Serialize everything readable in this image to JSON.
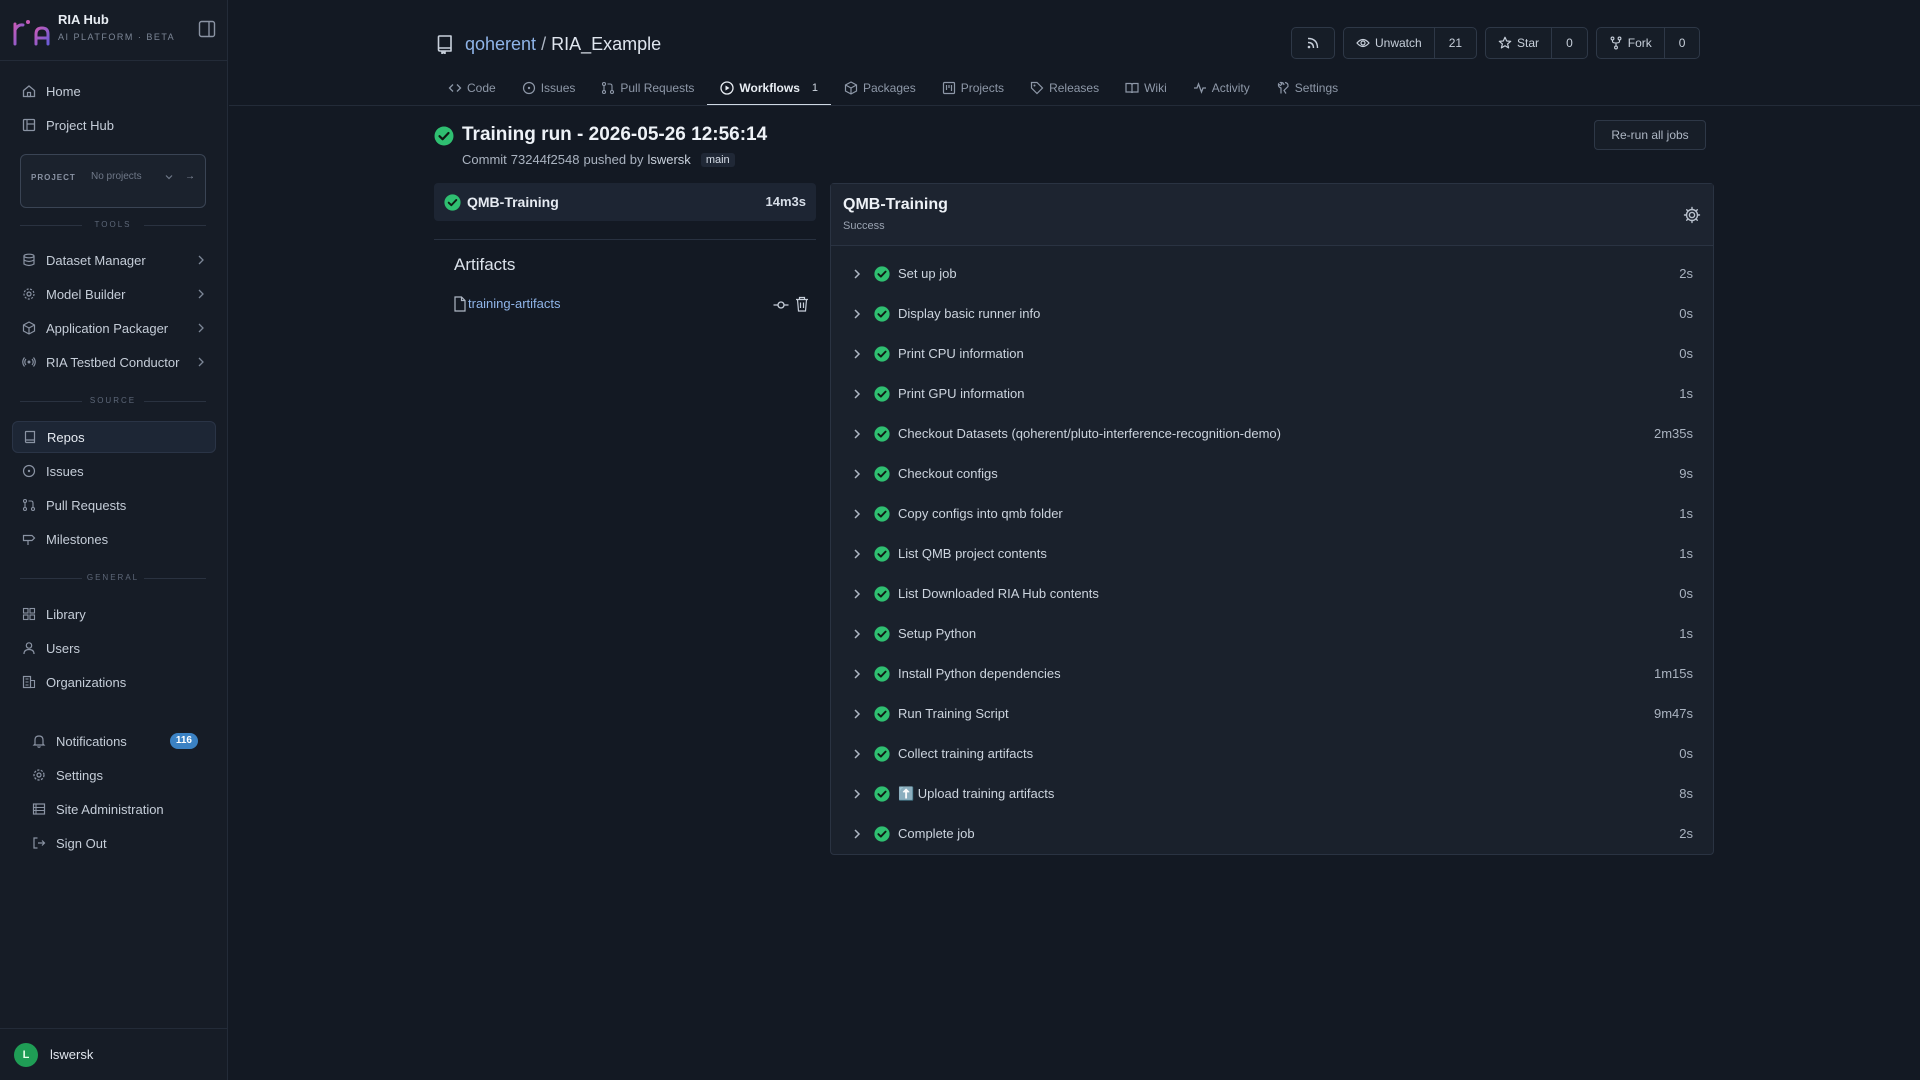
{
  "brand": {
    "name": "RIA Hub",
    "subtitle": "AI PLATFORM · BETA"
  },
  "colors": {
    "success": "#2fbf71",
    "link": "#8fb4e8",
    "badge": "#3b82c4"
  },
  "sidebar": {
    "top_items": [
      {
        "label": "Home",
        "icon": "home-icon"
      },
      {
        "label": "Project Hub",
        "icon": "project-hub-icon"
      }
    ],
    "project_selector": {
      "label": "PROJECT",
      "value": "No projects",
      "arrow": "→"
    },
    "sections": {
      "tools": "TOOLS",
      "source": "SOURCE",
      "general": "GENERAL"
    },
    "tools": [
      {
        "label": "Dataset Manager",
        "icon": "database-icon"
      },
      {
        "label": "Model Builder",
        "icon": "cog-icon"
      },
      {
        "label": "Application Packager",
        "icon": "package-icon"
      },
      {
        "label": "RIA Testbed Conductor",
        "icon": "radio-icon"
      }
    ],
    "source": [
      {
        "label": "Repos",
        "icon": "repo-icon",
        "active": true
      },
      {
        "label": "Issues",
        "icon": "issue-icon"
      },
      {
        "label": "Pull Requests",
        "icon": "pull-request-icon"
      },
      {
        "label": "Milestones",
        "icon": "milestone-icon"
      }
    ],
    "general": [
      {
        "label": "Library",
        "icon": "library-icon"
      },
      {
        "label": "Users",
        "icon": "user-icon"
      },
      {
        "label": "Organizations",
        "icon": "organization-icon"
      }
    ],
    "bottom": [
      {
        "label": "Notifications",
        "icon": "bell-icon",
        "badge": "116"
      },
      {
        "label": "Settings",
        "icon": "gear-icon"
      },
      {
        "label": "Site Administration",
        "icon": "server-icon"
      },
      {
        "label": "Sign Out",
        "icon": "sign-out-icon"
      }
    ],
    "user": {
      "initial": "L",
      "name": "lswersk"
    }
  },
  "repo": {
    "owner": "qoherent",
    "separator": "/",
    "name": "RIA_Example",
    "actions": {
      "unwatch_label": "Unwatch",
      "watch_count": "21",
      "star_label": "Star",
      "star_count": "0",
      "fork_label": "Fork",
      "fork_count": "0"
    }
  },
  "tabs": [
    {
      "label": "Code",
      "icon": "code-icon"
    },
    {
      "label": "Issues",
      "icon": "issue-icon"
    },
    {
      "label": "Pull Requests",
      "icon": "pull-request-icon"
    },
    {
      "label": "Workflows",
      "icon": "play-icon",
      "count": "1",
      "active": true
    },
    {
      "label": "Packages",
      "icon": "package-icon"
    },
    {
      "label": "Projects",
      "icon": "project-icon"
    },
    {
      "label": "Releases",
      "icon": "tag-icon"
    },
    {
      "label": "Wiki",
      "icon": "book-icon"
    },
    {
      "label": "Activity",
      "icon": "pulse-icon"
    },
    {
      "label": "Settings",
      "icon": "tool-icon"
    }
  ],
  "run": {
    "title": "Training run - 2026-05-26 12:56:14",
    "commit_prefix": "Commit",
    "commit_sha": "73244f2548",
    "pushed_by": "pushed by",
    "user": "lswersk",
    "branch": "main",
    "rerun_label": "Re-run all jobs"
  },
  "job": {
    "name": "QMB-Training",
    "duration": "14m3s"
  },
  "artifacts": {
    "title": "Artifacts",
    "items": [
      {
        "name": "training-artifacts"
      }
    ]
  },
  "steps_panel": {
    "title": "QMB-Training",
    "status": "Success",
    "steps": [
      {
        "name": "Set up job",
        "duration": "2s"
      },
      {
        "name": "Display basic runner info",
        "duration": "0s"
      },
      {
        "name": "Print CPU information",
        "duration": "0s"
      },
      {
        "name": "Print GPU information",
        "duration": "1s"
      },
      {
        "name": "Checkout Datasets (qoherent/pluto-interference-recognition-demo)",
        "duration": "2m35s"
      },
      {
        "name": "Checkout configs",
        "duration": "9s"
      },
      {
        "name": "Copy configs into qmb folder",
        "duration": "1s"
      },
      {
        "name": "List QMB project contents",
        "duration": "1s"
      },
      {
        "name": "List Downloaded RIA Hub contents",
        "duration": "0s"
      },
      {
        "name": "Setup Python",
        "duration": "1s"
      },
      {
        "name": "Install Python dependencies",
        "duration": "1m15s"
      },
      {
        "name": "Run Training Script",
        "duration": "9m47s"
      },
      {
        "name": "Collect training artifacts",
        "duration": "0s"
      },
      {
        "name": "⬆️ Upload training artifacts",
        "duration": "8s"
      },
      {
        "name": "Complete job",
        "duration": "2s"
      }
    ]
  }
}
